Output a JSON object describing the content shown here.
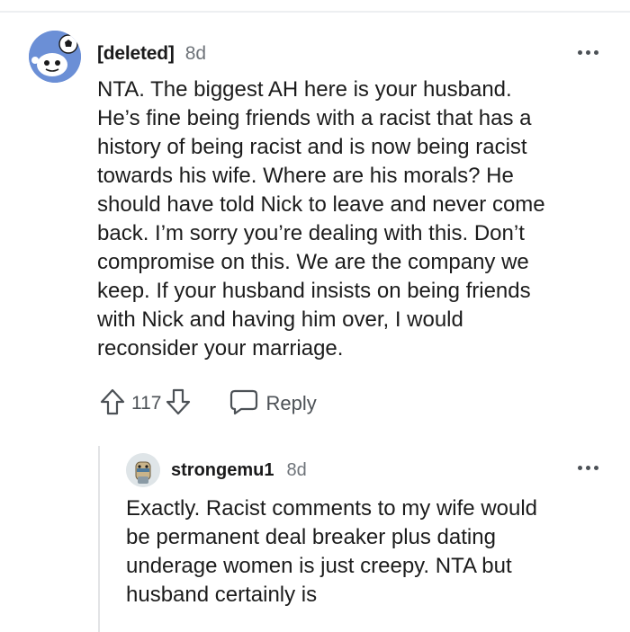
{
  "comment": {
    "author": "[deleted]",
    "age": "8d",
    "avatar_icon": "snoo-soccer-avatar-icon",
    "lines": [
      "NTA. The biggest AH here is your husband.",
      "He’s fine being friends with a racist that has a",
      "history of being racist and is now being racist",
      "towards his wife. Where are his morals? He",
      "should have told Nick to leave and never come",
      "back. I’m sorry you’re dealing with this. Don’t",
      "compromise on this. We are the company we",
      "keep. If your husband insists on being friends",
      "with Nick and having him over, I would",
      "reconsider your marriage."
    ],
    "votes": "117",
    "reply_label": "Reply"
  },
  "reply": {
    "author": "strongemu1",
    "age": "8d",
    "avatar_icon": "user-avatar-icon",
    "lines": [
      "Exactly. Racist comments to my wife would",
      "be permanent deal breaker plus dating",
      "underage women is just creepy. NTA but",
      "husband certainly is"
    ]
  },
  "colors": {
    "text": "#1c1c1c",
    "meta": "#6e7379",
    "icon": "#4c5156",
    "avatar_main": "#6b8fd6",
    "thread_line": "#e2e4e6"
  }
}
